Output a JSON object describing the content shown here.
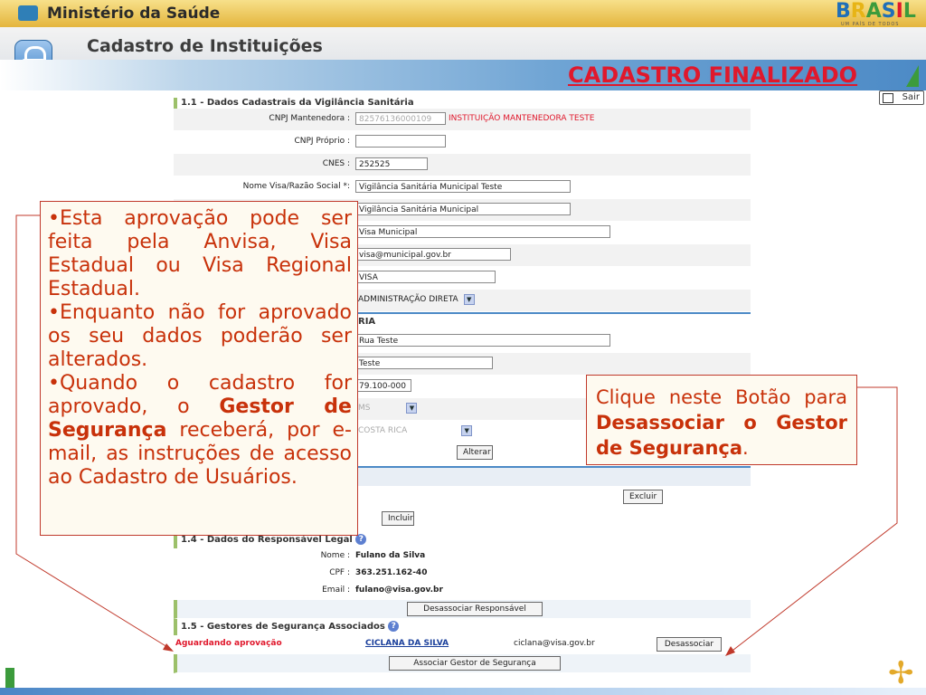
{
  "topbar": {
    "title": "Ministério da Saúde",
    "brand": "BRASIL",
    "brand_tagline": "UM PAÍS DE TODOS"
  },
  "header": {
    "app_title": "Cadastro de Instituições",
    "status": "CADASTRO FINALIZADO",
    "exit_label": "Sair"
  },
  "section_1_1": {
    "title": "1.1 - Dados Cadastrais da Vigilância Sanitária",
    "fields": [
      {
        "label": "CNPJ Mantenedora :",
        "value": "82576136000109",
        "extra": "INSTITUIÇÃO MANTENEDORA TESTE"
      },
      {
        "label": "CNPJ Próprio :",
        "value": ""
      },
      {
        "label": "CNES :",
        "value": "252525"
      },
      {
        "label": "Nome Visa/Razão Social *:",
        "value": "Vigilância Sanitária Municipal Teste"
      },
      {
        "value": "Vigilância Sanitária Municipal"
      },
      {
        "value": "Visa Municipal"
      },
      {
        "value": "visa@municipal.gov.br"
      },
      {
        "value": "VISA"
      },
      {
        "value": "ADMINISTRAÇÃO DIRETA"
      }
    ]
  },
  "section_address": {
    "title_visible": "RIA",
    "fields": [
      {
        "value": "Rua Teste"
      },
      {
        "value": "Teste"
      },
      {
        "value": "79.100-000"
      },
      {
        "value": "MS"
      },
      {
        "value": "COSTA RICA"
      }
    ],
    "alter_button": "Alterar"
  },
  "section_1_3": {
    "delete_button": "Excluir",
    "include_button": "Incluir"
  },
  "section_1_4": {
    "title": "1.4 - Dados do Responsável Legal",
    "name_label": "Nome :",
    "name_value": "Fulano da Silva",
    "cpf_label": "CPF :",
    "cpf_value": "363.251.162-40",
    "email_label": "Email :",
    "email_value": "fulano@visa.gov.br",
    "disassociate_button": "Desassociar Responsável"
  },
  "section_1_5": {
    "title": "1.5 - Gestores de Segurança Associados",
    "status": "Aguardando aprovação",
    "manager_name": "CICLANA DA SILVA",
    "manager_email": "ciclana@visa.gov.br",
    "disassociate_button": "Desassociar",
    "associate_button": "Associar Gestor de Segurança"
  },
  "callout_left": {
    "p1": "•Esta aprovação pode ser feita pela Anvisa, Visa Estadual ou Visa Regional Estadual.",
    "p2": "•Enquanto não for aprovado os seu dados poderão ser alterados.",
    "p3_a": "•Quando o cadastro for aprovado, o ",
    "p3_b": "Gestor de Segurança",
    "p3_c": " receberá, por e-mail, as instruções de acesso ao Cadastro de Usuários."
  },
  "callout_right": {
    "a": "Clique neste Botão para ",
    "b": "Desassociar o Gestor de Segurança",
    "c": "."
  },
  "colors": {
    "accent_red": "#e0182c",
    "callout_text": "#c8310a",
    "blue": "#4c8ac6",
    "green": "#3c9b3c"
  }
}
